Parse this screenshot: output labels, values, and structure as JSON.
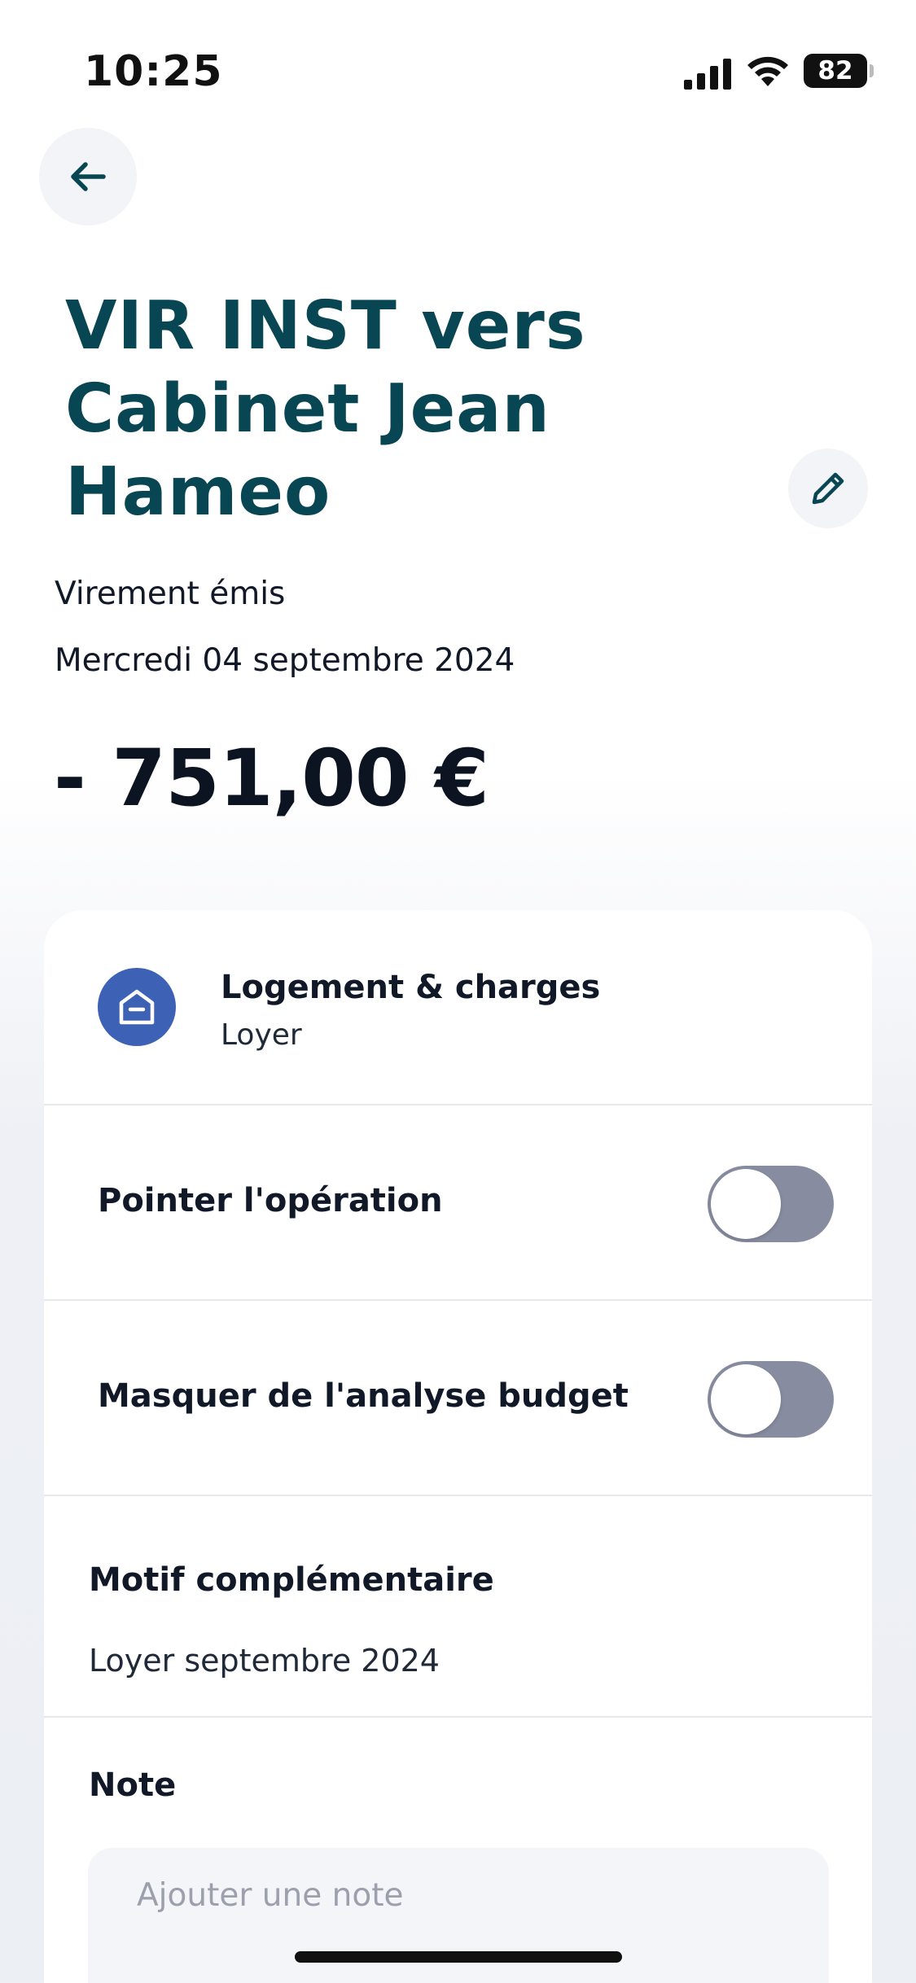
{
  "status_bar": {
    "time": "10:25",
    "battery": "82"
  },
  "header": {
    "title": "VIR INST vers Cabinet Jean Hameo",
    "type": "Virement émis",
    "date": "Mercredi 04 septembre 2024",
    "amount": "- 751,00 €"
  },
  "category": {
    "title": "Logement & charges",
    "subtitle": "Loyer",
    "icon": "house-icon",
    "color": "#3d62b5"
  },
  "toggles": {
    "pointer_label": "Pointer l'opération",
    "pointer_on": false,
    "hide_label": "Masquer de l'analyse budget",
    "hide_on": false
  },
  "motif": {
    "title": "Motif complémentaire",
    "value": "Loyer septembre 2024"
  },
  "note": {
    "title": "Note",
    "placeholder": "Ajouter une note"
  },
  "colors": {
    "title": "#074652",
    "toggle_off": "#878ca0",
    "accent": "#3d62b5"
  }
}
